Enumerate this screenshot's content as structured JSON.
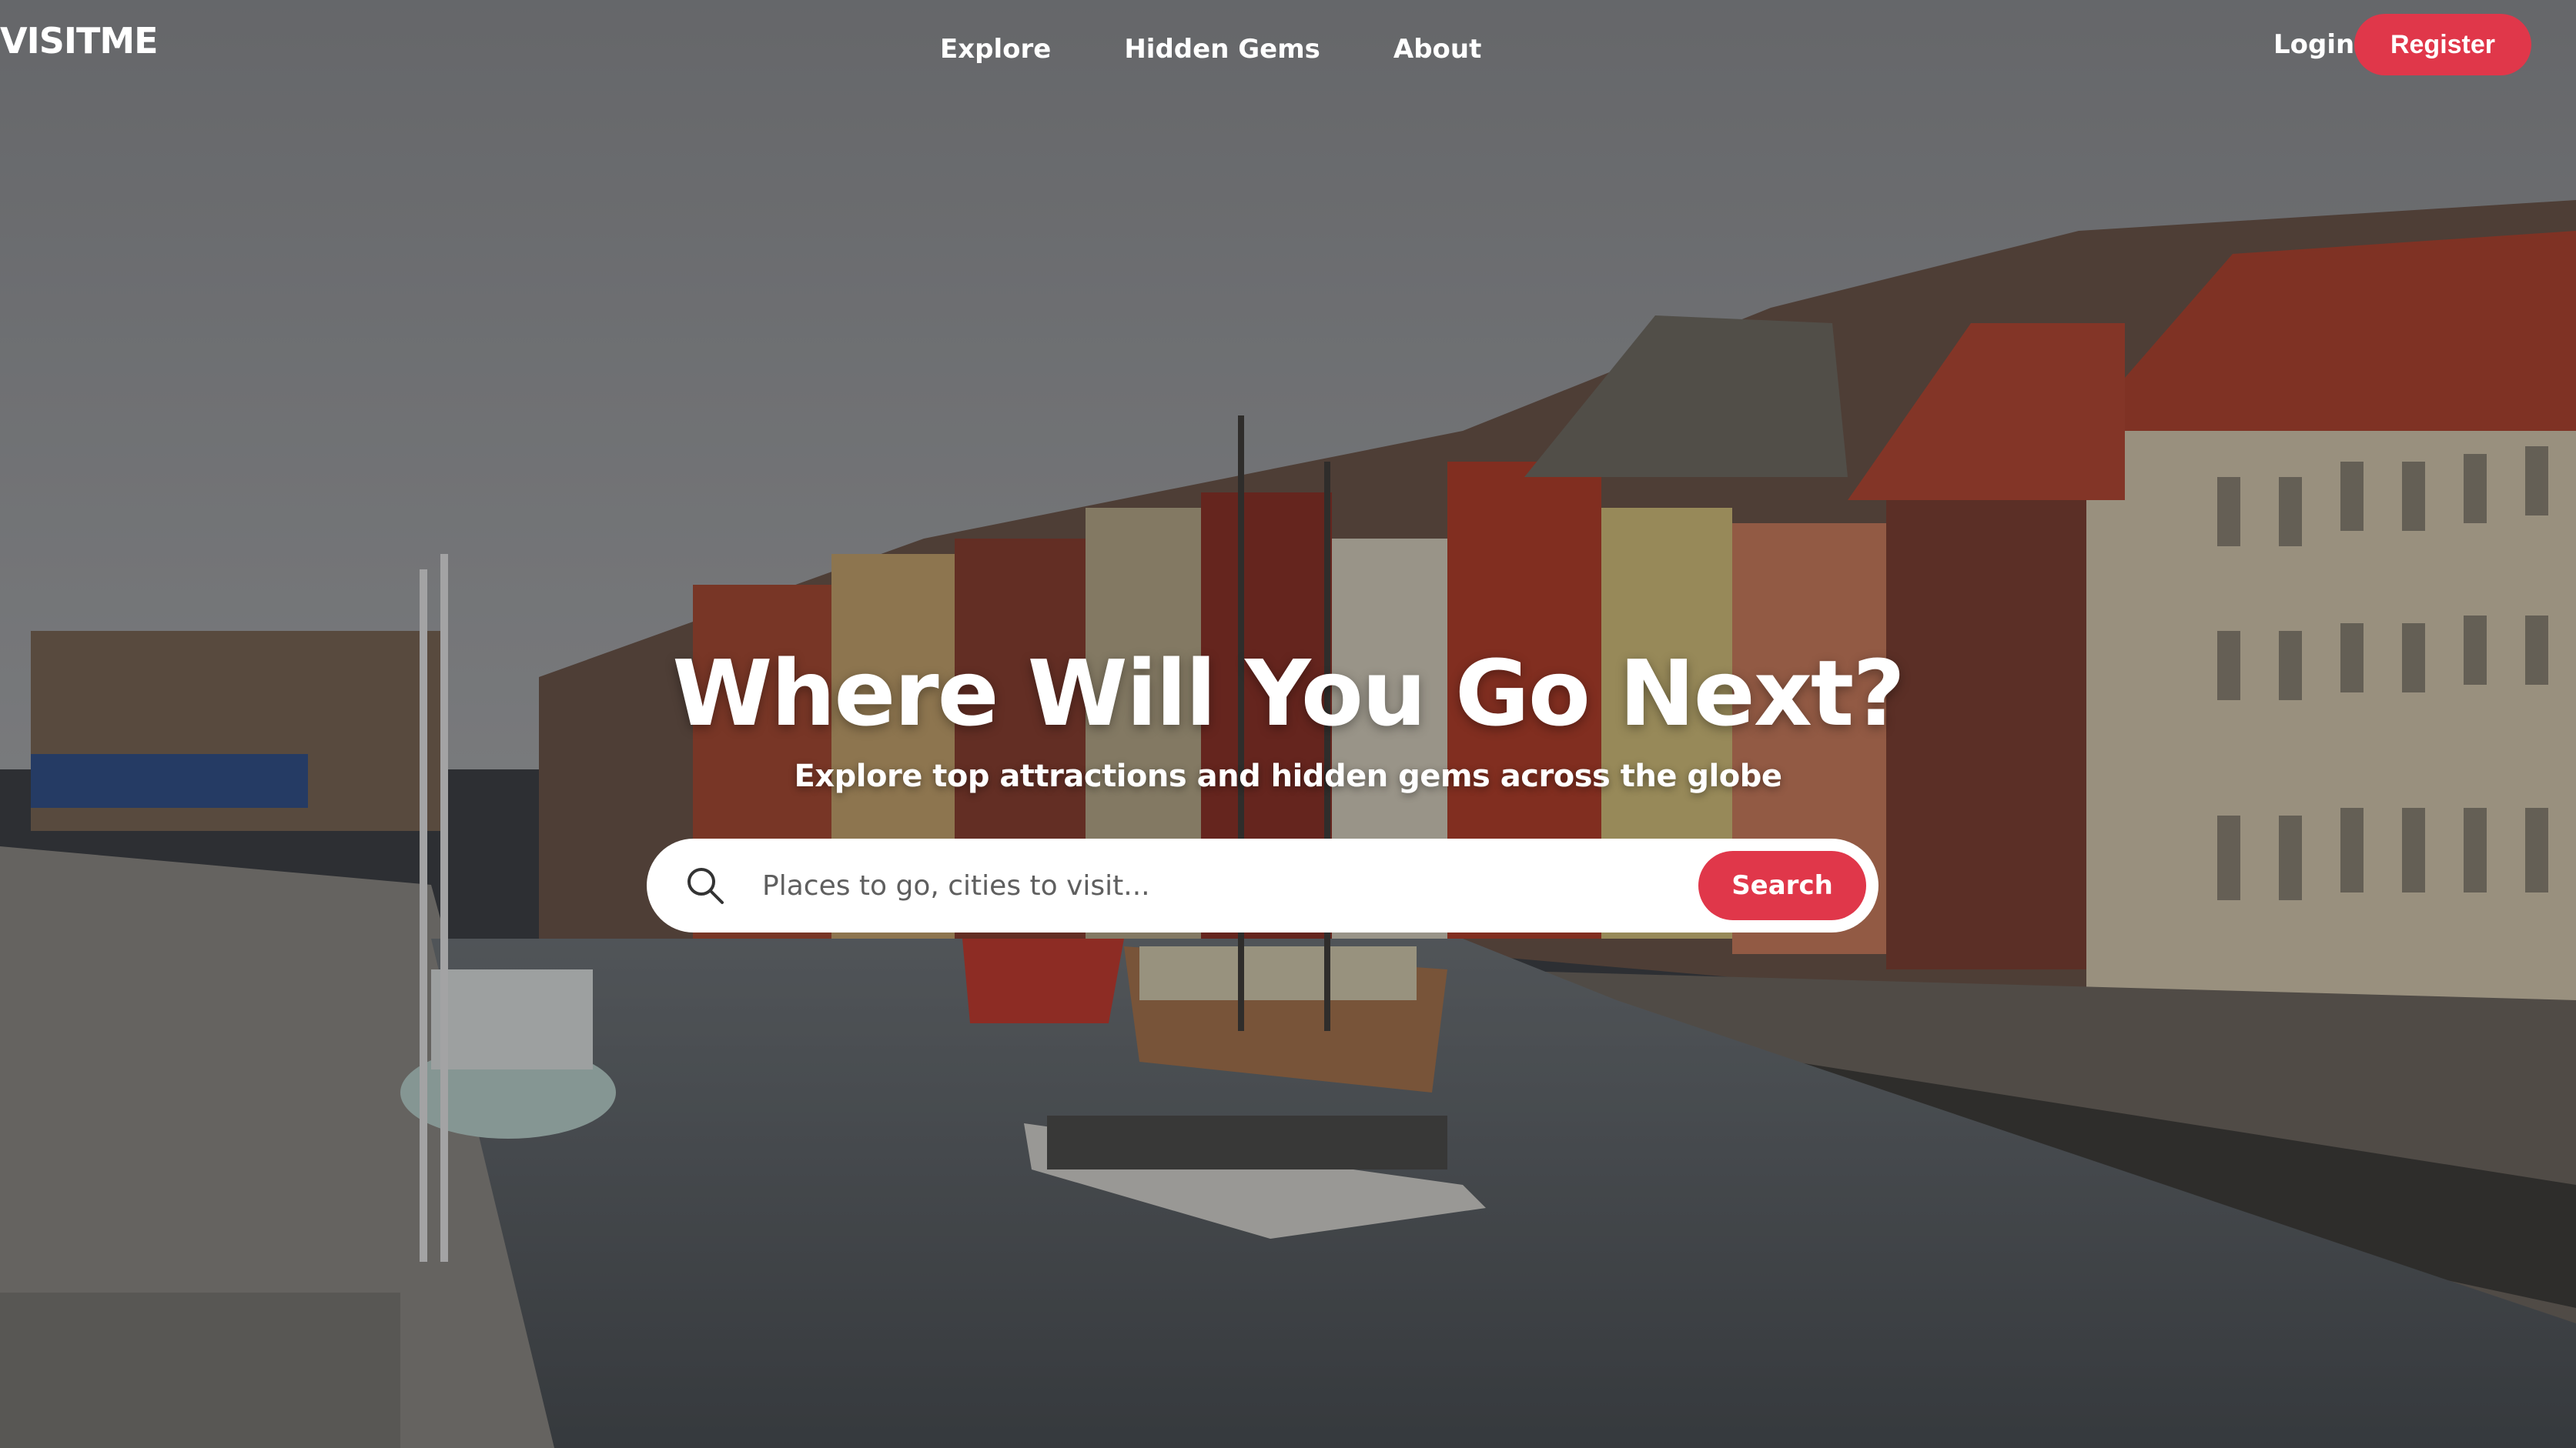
{
  "brand": {
    "logo": "VISITME"
  },
  "nav": {
    "links": [
      "Explore",
      "Hidden Gems",
      "About"
    ],
    "login": "Login",
    "register": "Register"
  },
  "hero": {
    "title": "Where Will You Go Next?",
    "subtitle": "Explore top attractions and hidden gems across the globe"
  },
  "search": {
    "placeholder": "Places to go, cities to visit...",
    "button": "Search"
  },
  "colors": {
    "accent": "#e0374a",
    "text": "#ffffff"
  }
}
